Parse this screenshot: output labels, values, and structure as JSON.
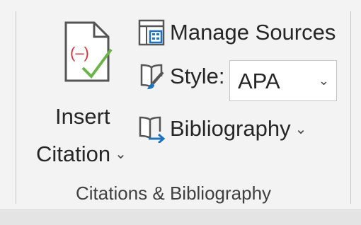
{
  "insert_citation": {
    "label_line1": "Insert",
    "label_line2": "Citation",
    "dropdown_glyph": "⌄",
    "icon": "insert-citation-icon",
    "icon_text": "(–)"
  },
  "manage_sources": {
    "label": "Manage Sources",
    "icon": "manage-sources-icon"
  },
  "style": {
    "label": "Style:",
    "value": "APA",
    "dropdown_glyph": "⌄",
    "icon": "style-brush-icon"
  },
  "bibliography": {
    "label": "Bibliography",
    "dropdown_glyph": "⌄",
    "icon": "bibliography-icon"
  },
  "group": {
    "label": "Citations & Bibliography"
  },
  "colors": {
    "accent_blue": "#1e73be",
    "citation_red": "#d13438",
    "check_green": "#6bb34a",
    "ribbon_bg": "#f3f3f3"
  }
}
